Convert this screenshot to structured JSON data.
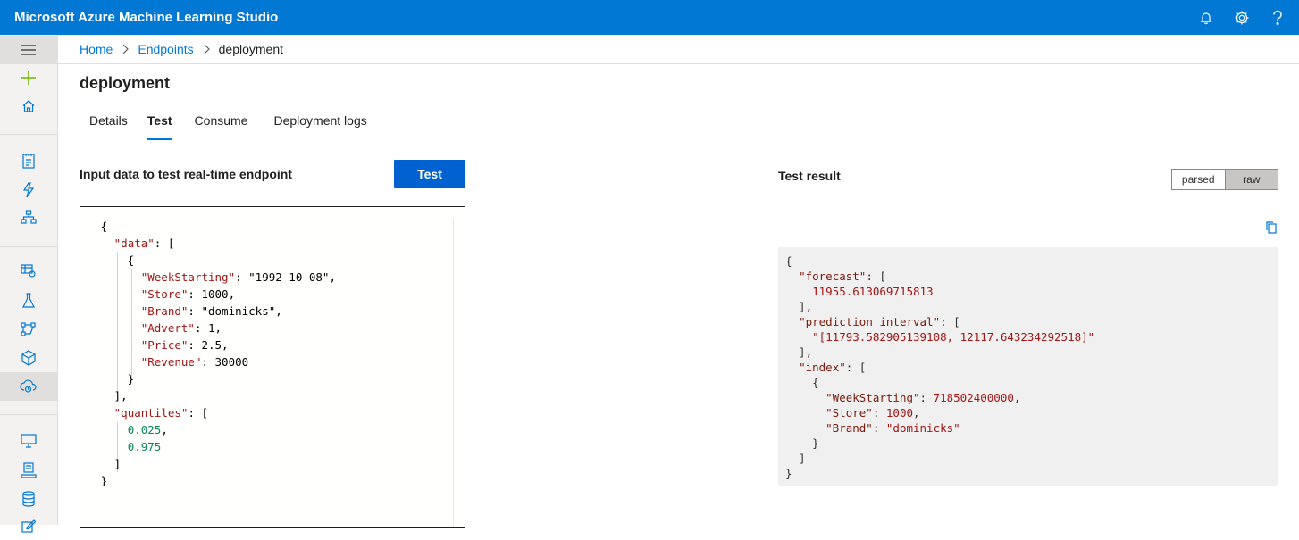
{
  "app": {
    "title": "Microsoft Azure Machine Learning Studio"
  },
  "topbar": {
    "icons": [
      "bell-icon",
      "gear-icon",
      "help-icon"
    ]
  },
  "breadcrumb": {
    "home": "Home",
    "endpoints": "Endpoints",
    "current": "deployment"
  },
  "page": {
    "title": "deployment"
  },
  "tabs": [
    {
      "label": "Details"
    },
    {
      "label": "Test"
    },
    {
      "label": "Consume"
    },
    {
      "label": "Deployment logs"
    }
  ],
  "active_tab": "Test",
  "input": {
    "label": "Input data to test real-time endpoint",
    "test_button": "Test",
    "json_lines": [
      "{",
      "  \"data\": [",
      "    {",
      "      \"WeekStarting\": \"1992-10-08\",",
      "      \"Store\": 1000,",
      "      \"Brand\": \"dominicks\",",
      "      \"Advert\": 1,",
      "      \"Price\": 2.5,",
      "      \"Revenue\": 30000",
      "    }",
      "  ],",
      "  \"quantiles\": [",
      "    0.025,",
      "    0.975",
      "  ]",
      "}"
    ]
  },
  "result": {
    "label": "Test result",
    "toggle": {
      "parsed": "parsed",
      "raw": "raw",
      "selected": "raw"
    },
    "json_lines": [
      "{",
      "  \"forecast\": [",
      "    11955.613069715813",
      "  ],",
      "  \"prediction_interval\": [",
      "    \"[11793.582905139108, 12117.643234292518]\"",
      "  ],",
      "  \"index\": [",
      "    {",
      "      \"WeekStarting\": 718502400000,",
      "      \"Store\": 1000,",
      "      \"Brand\": \"dominicks\"",
      "    }",
      "  ]",
      "}"
    ]
  },
  "sidebar": {
    "items": [
      {
        "name": "menu-icon"
      },
      {
        "name": "new-icon"
      },
      {
        "name": "home-icon"
      },
      {
        "name": "notebooks-icon"
      },
      {
        "name": "automl-icon"
      },
      {
        "name": "designer-icon"
      },
      {
        "name": "datasets-icon"
      },
      {
        "name": "experiments-icon"
      },
      {
        "name": "pipelines-icon"
      },
      {
        "name": "models-icon"
      },
      {
        "name": "endpoints-icon"
      },
      {
        "name": "compute-icon"
      },
      {
        "name": "environments-icon"
      },
      {
        "name": "datastores-icon"
      },
      {
        "name": "labeling-icon"
      }
    ]
  },
  "colors": {
    "brand": "#0078d4",
    "button": "#0062d1",
    "key": "#a31515",
    "string": "#0451a5",
    "number": "#098658"
  }
}
